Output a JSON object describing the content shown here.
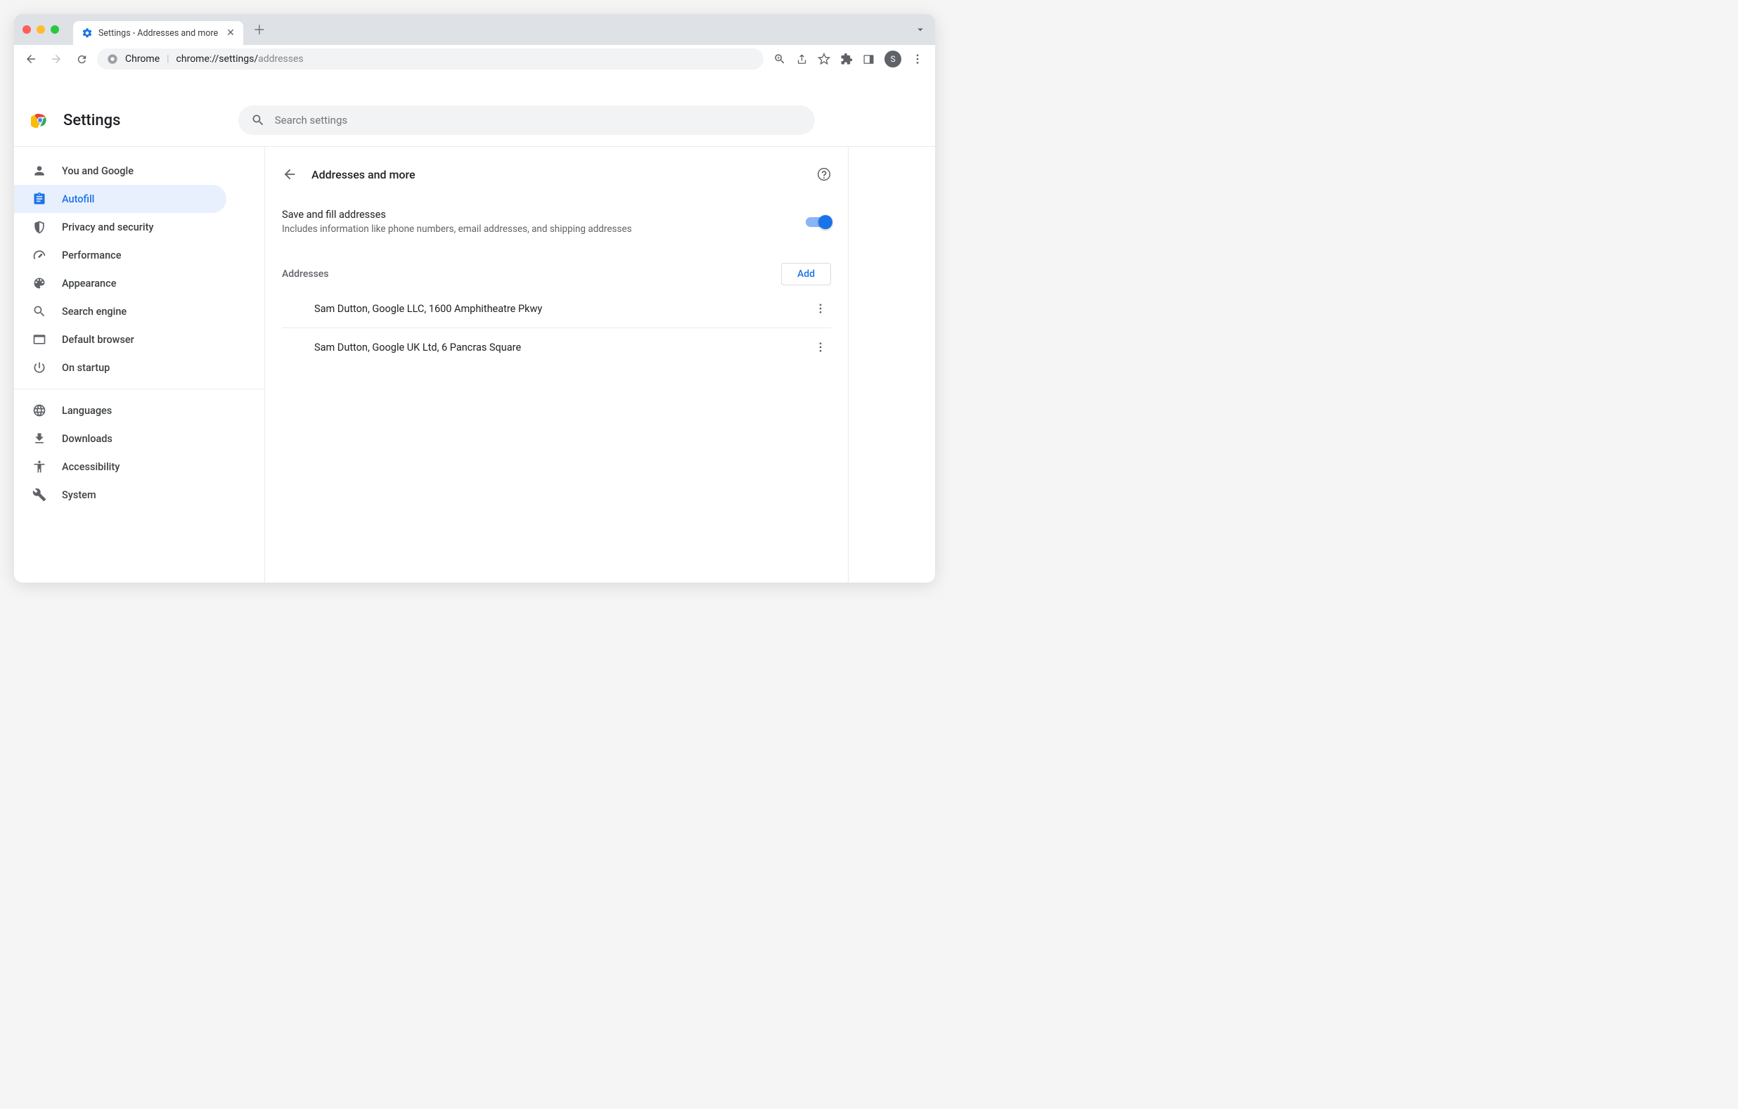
{
  "tab": {
    "title": "Settings - Addresses and more"
  },
  "omnibox": {
    "product": "Chrome",
    "base": "chrome://",
    "mid": "settings/",
    "tail": "addresses"
  },
  "avatar": {
    "initial": "S"
  },
  "app": {
    "title": "Settings",
    "search_placeholder": "Search settings"
  },
  "sidebar": {
    "items": [
      {
        "label": "You and Google"
      },
      {
        "label": "Autofill"
      },
      {
        "label": "Privacy and security"
      },
      {
        "label": "Performance"
      },
      {
        "label": "Appearance"
      },
      {
        "label": "Search engine"
      },
      {
        "label": "Default browser"
      },
      {
        "label": "On startup"
      }
    ],
    "extras": [
      {
        "label": "Languages"
      },
      {
        "label": "Downloads"
      },
      {
        "label": "Accessibility"
      },
      {
        "label": "System"
      }
    ]
  },
  "page": {
    "title": "Addresses and more",
    "toggle": {
      "title": "Save and fill addresses",
      "subtitle": "Includes information like phone numbers, email addresses, and shipping addresses"
    },
    "addresses_label": "Addresses",
    "add_label": "Add",
    "addresses": [
      {
        "text": "Sam Dutton, Google LLC, 1600 Amphitheatre Pkwy"
      },
      {
        "text": "Sam Dutton, Google UK Ltd, 6 Pancras Square"
      }
    ]
  }
}
